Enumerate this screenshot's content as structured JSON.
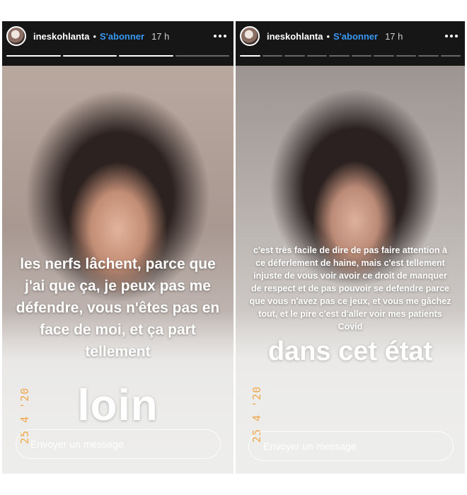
{
  "stories": [
    {
      "username": "ineskohlanta",
      "separator": "•",
      "subscribe_label": "S'abonner",
      "time": "17 h",
      "progress_total": 4,
      "progress_done": 3,
      "caption": "les nerfs lâchent, parce que j'ai que ça, je peux pas me défendre, vous n'êtes pas en face de moi, et ça part tellement",
      "big_word": "loin",
      "date_stamp": "25 4 '20",
      "message_placeholder": "Envoyer un message"
    },
    {
      "username": "ineskohlanta",
      "separator": "•",
      "subscribe_label": "S'abonner",
      "time": "17 h",
      "progress_total": 10,
      "progress_done": 1,
      "caption": "c'est très facile de dire de pas faire attention à ce déferlement de haine, mais c'est tellement injuste de vous voir avoir ce droit de manquer de respect et de pas pouvoir se defendre parce que vous n'avez pas ce jeux, et vous me gâchez tout, et le pire c'est d'aller voir mes patients Covid",
      "big_word": "dans cet état",
      "date_stamp": "25 4 '20",
      "message_placeholder": "Envoyer un message"
    }
  ],
  "colors": {
    "accent": "#3897f0",
    "stamp": "#f0a84c",
    "frame": "#161616"
  },
  "icons": {
    "avatar": "profile-avatar",
    "more": "more-options-icon"
  }
}
